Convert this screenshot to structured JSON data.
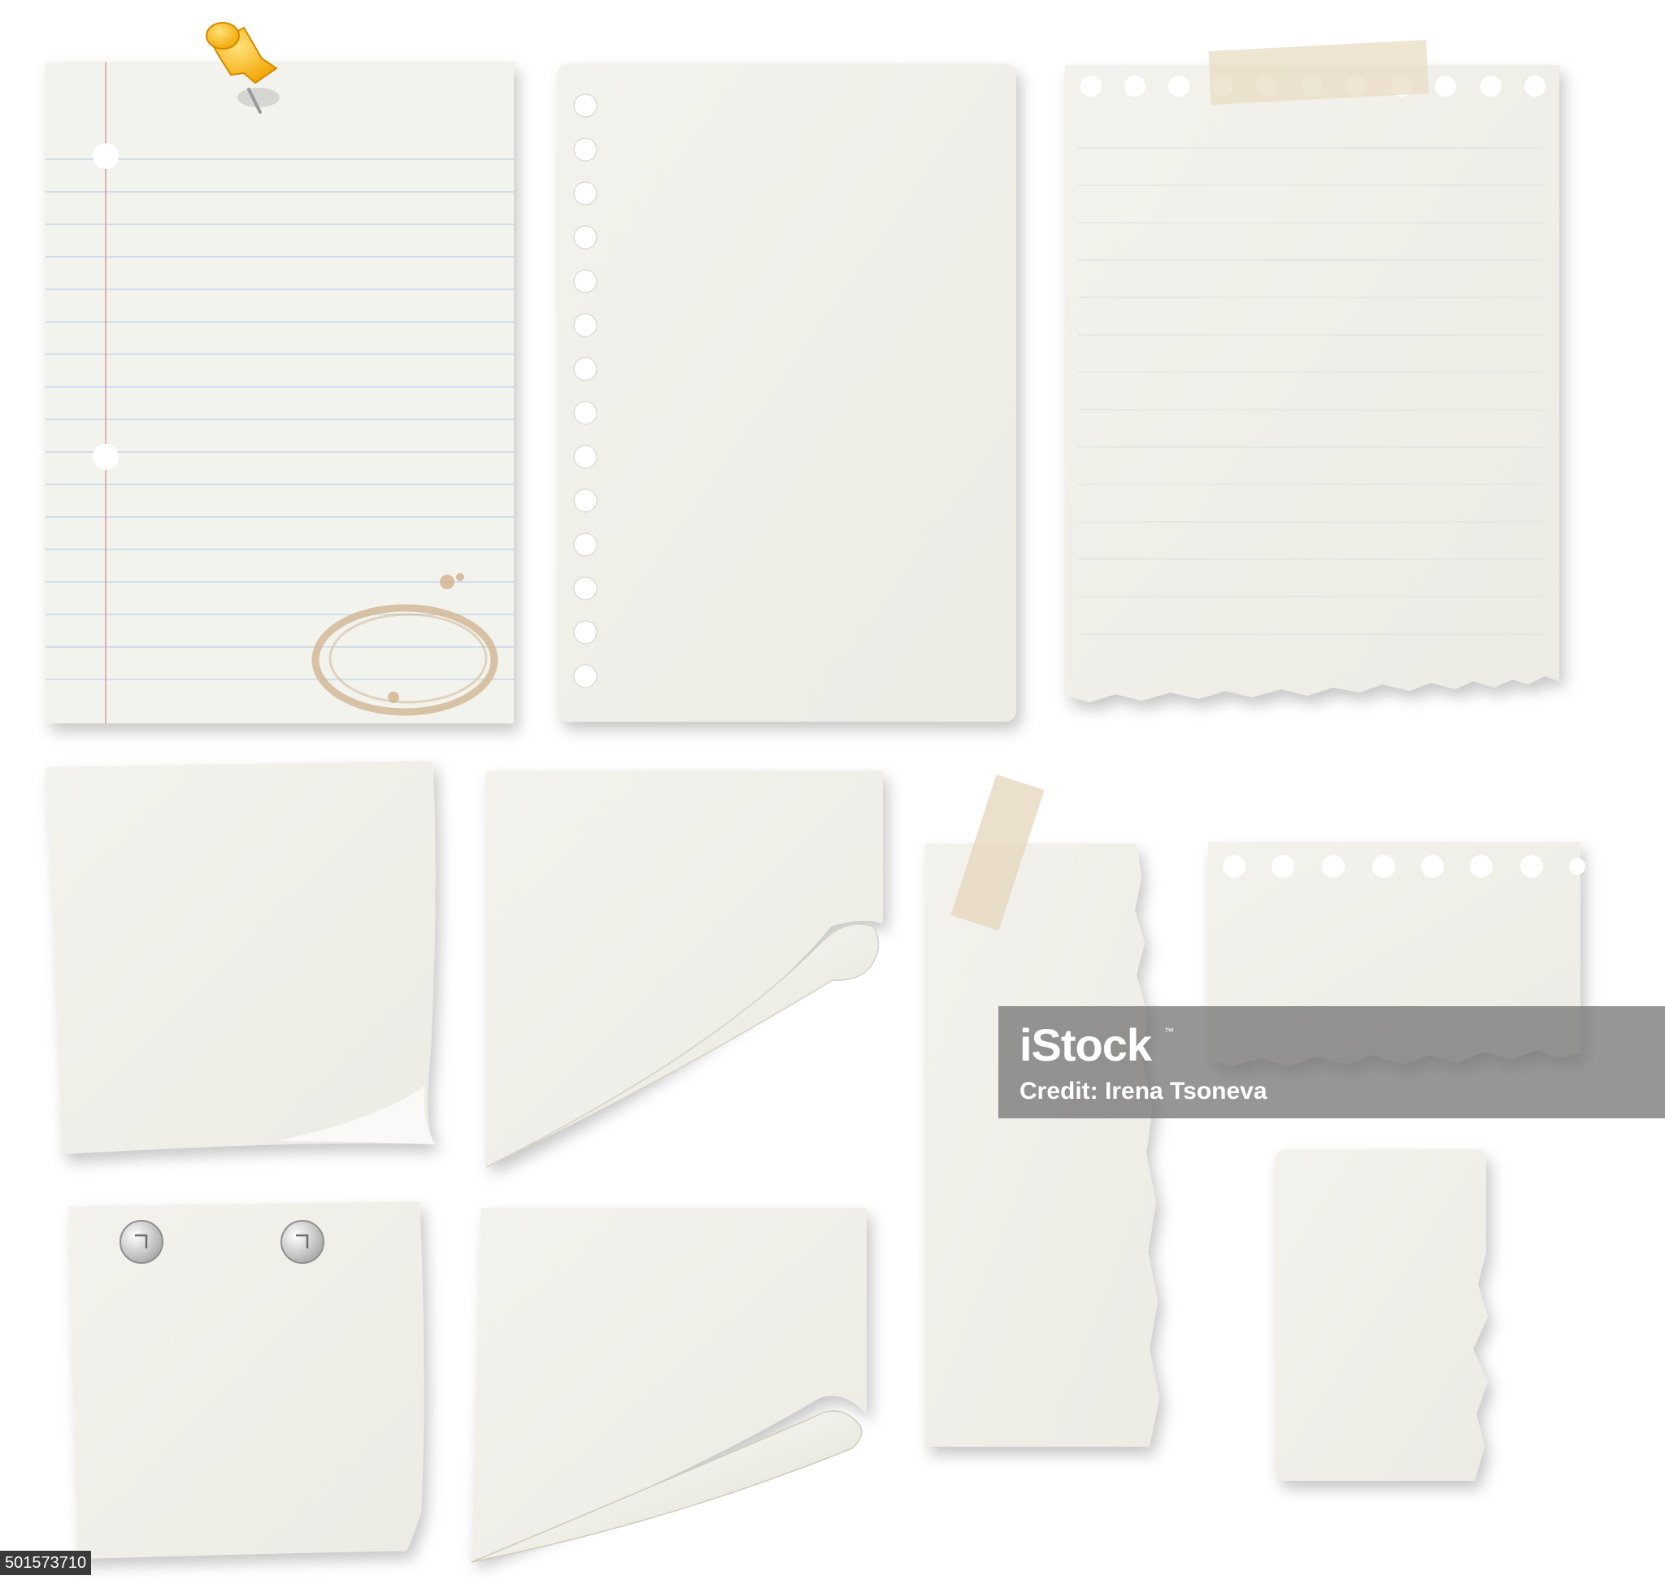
{
  "watermark": {
    "logo": "iStock",
    "trademark": "™",
    "credit": "Credit: Irena Tsoneva"
  },
  "stock_id": "501573710",
  "colors": {
    "paper": "#f1f0ea",
    "paper_edge": "#e6e5de",
    "blue_rule": "#b9d3e6",
    "red_margin": "#e08a8a",
    "pin_yellow": "#f6b800",
    "tape": "#e9dcc6",
    "coffee_stain": "#c9ab85"
  }
}
